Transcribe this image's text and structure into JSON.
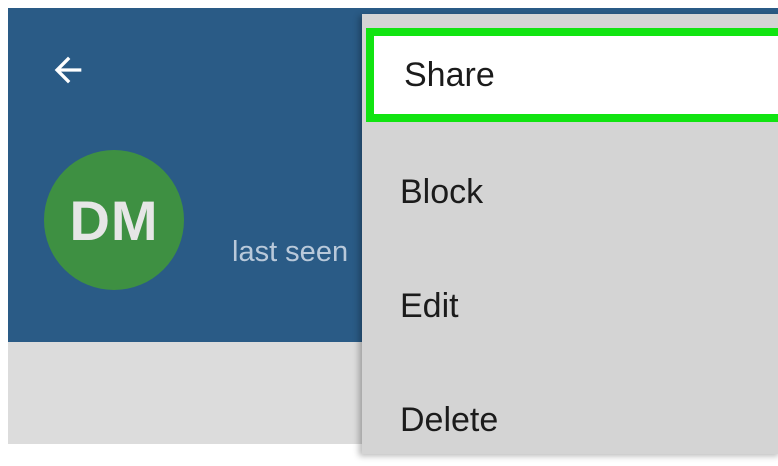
{
  "header": {
    "back_icon": "arrow-left-icon",
    "background_color": "#2a5b86",
    "avatar": {
      "initials": "DM",
      "color": "#3e9042"
    },
    "name": "",
    "status": "last seen"
  },
  "menu": {
    "highlight_color": "#11e411",
    "items": [
      {
        "label": "Share"
      },
      {
        "label": "Block"
      },
      {
        "label": "Edit"
      },
      {
        "label": "Delete"
      }
    ]
  }
}
